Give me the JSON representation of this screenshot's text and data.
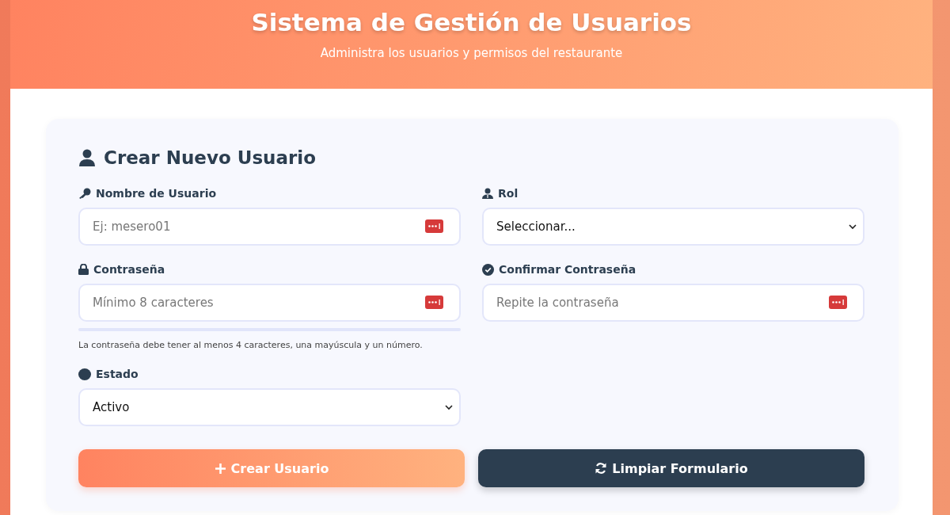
{
  "header": {
    "title": "Sistema de Gestión de Usuarios",
    "subtitle": "Administra los usuarios y permisos del restaurante"
  },
  "form": {
    "title": "Crear Nuevo Usuario",
    "fields": [
      {
        "kind": "text",
        "label": "Nombre de Usuario",
        "placeholder": "Ej: mesero01"
      },
      {
        "kind": "select",
        "label": "Rol",
        "value": "Seleccionar..."
      },
      {
        "kind": "password",
        "label": "Contraseña",
        "placeholder": "Mínimo 8 caracteres",
        "strength": {
          "level": 0
        },
        "hint": "La contraseña debe tener al menos 4 caracteres, una mayúscula y un número."
      },
      {
        "kind": "password",
        "label": "Confirmar Contraseña",
        "placeholder": "Repite la contraseña"
      },
      {
        "kind": "select",
        "label": "Estado",
        "value": "Activo"
      }
    ],
    "buttons": [
      {
        "kind": "primary",
        "label": "Crear Usuario"
      },
      {
        "kind": "secondary",
        "label": "Limpiar Formulario"
      }
    ]
  }
}
